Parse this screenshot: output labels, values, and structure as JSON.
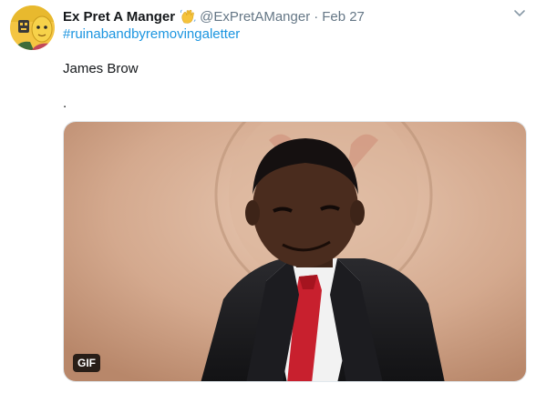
{
  "tweet": {
    "display_name": "Ex Pret A Manger",
    "handle": "@ExPretAManger",
    "separator": "·",
    "date": "Feb 27",
    "hashtag": "#ruinabandbyremovingaletter",
    "body_line_1": "James Brow",
    "body_line_2": ".",
    "media": {
      "type_badge": "GIF",
      "icon": "gif-media"
    },
    "header_emoji": "waving-hand-icon",
    "more_icon": "chevron-down-icon"
  },
  "colors": {
    "name": "#14171a",
    "secondary": "#657786",
    "link": "#1b95e0",
    "avatar_bg": "#f2c23a"
  }
}
